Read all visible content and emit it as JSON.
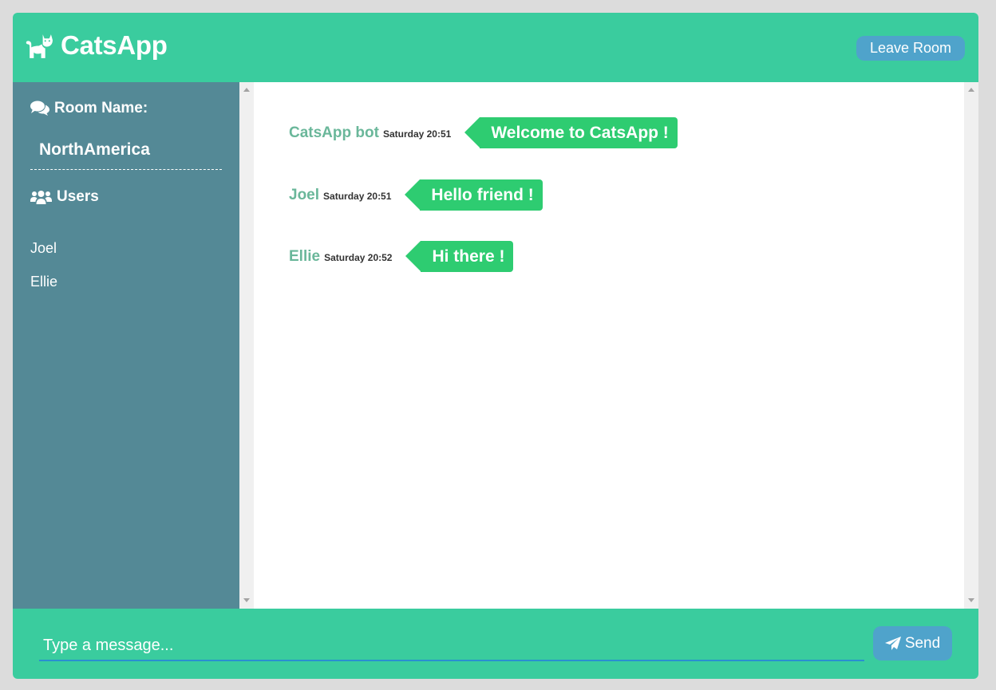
{
  "header": {
    "logo_icon": "cat-icon",
    "title": "CatsApp",
    "leave_label": "Leave Room"
  },
  "sidebar": {
    "room_heading_icon": "comments-icon",
    "room_heading": "Room Name:",
    "room_name": "NorthAmerica",
    "users_heading_icon": "users-icon",
    "users_heading": "Users",
    "users": [
      "Joel",
      "Ellie"
    ]
  },
  "messages": [
    {
      "user": "CatsApp bot",
      "time": "Saturday 20:51",
      "text": "Welcome to CatsApp !"
    },
    {
      "user": "Joel",
      "time": "Saturday 20:51",
      "text": "Hello friend !"
    },
    {
      "user": "Ellie",
      "time": "Saturday 20:52",
      "text": "Hi there !"
    }
  ],
  "footer": {
    "input_placeholder": "Type a message...",
    "input_value": "",
    "send_icon": "paper-plane-icon",
    "send_label": "Send"
  },
  "colors": {
    "header_bg": "#3acc9e",
    "sidebar_bg": "#548996",
    "button_bg": "#4fa3cb",
    "bubble_bg": "#2ecc71",
    "username": "#6ab79a"
  }
}
